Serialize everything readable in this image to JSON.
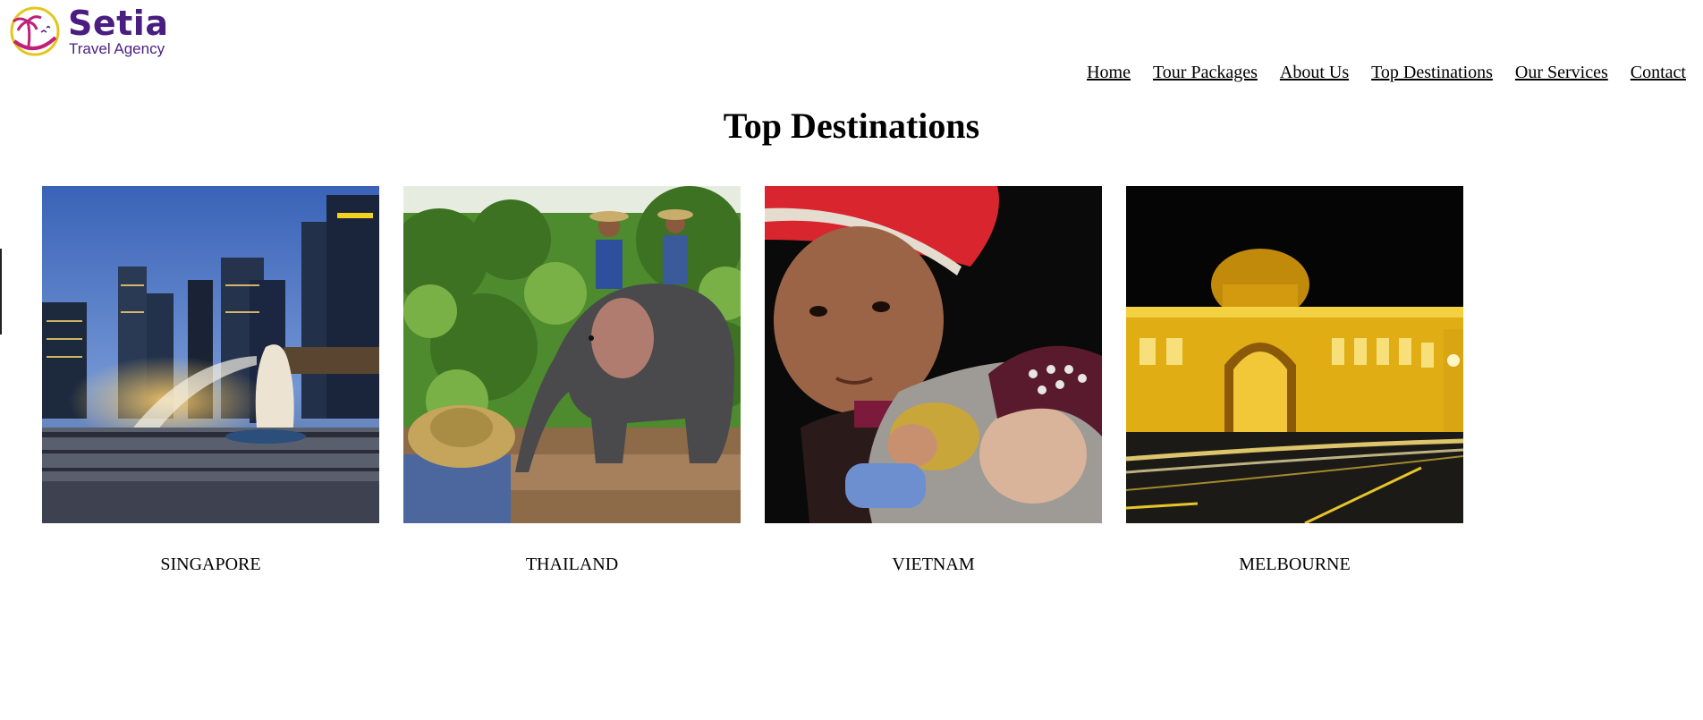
{
  "brand": {
    "name": "Setia",
    "tagline": "Travel Agency",
    "colors": {
      "primary": "#4a1e80",
      "accent_pink": "#c0207a",
      "accent_yellow": "#e3c61c"
    }
  },
  "nav": {
    "items": [
      {
        "label": "Home"
      },
      {
        "label": "Tour Packages"
      },
      {
        "label": "About Us"
      },
      {
        "label": "Top Destinations"
      },
      {
        "label": "Our Services"
      },
      {
        "label": "Contact"
      }
    ]
  },
  "page": {
    "title": "Top Destinations"
  },
  "destinations": [
    {
      "name": "SINGAPORE",
      "image": "singapore-skyline-merlion"
    },
    {
      "name": "THAILAND",
      "image": "elephant-riders-in-river"
    },
    {
      "name": "VIETNAM",
      "image": "woman-with-red-headscarf-and-child"
    },
    {
      "name": "MELBOURNE",
      "image": "flinders-street-station-at-night"
    }
  ]
}
